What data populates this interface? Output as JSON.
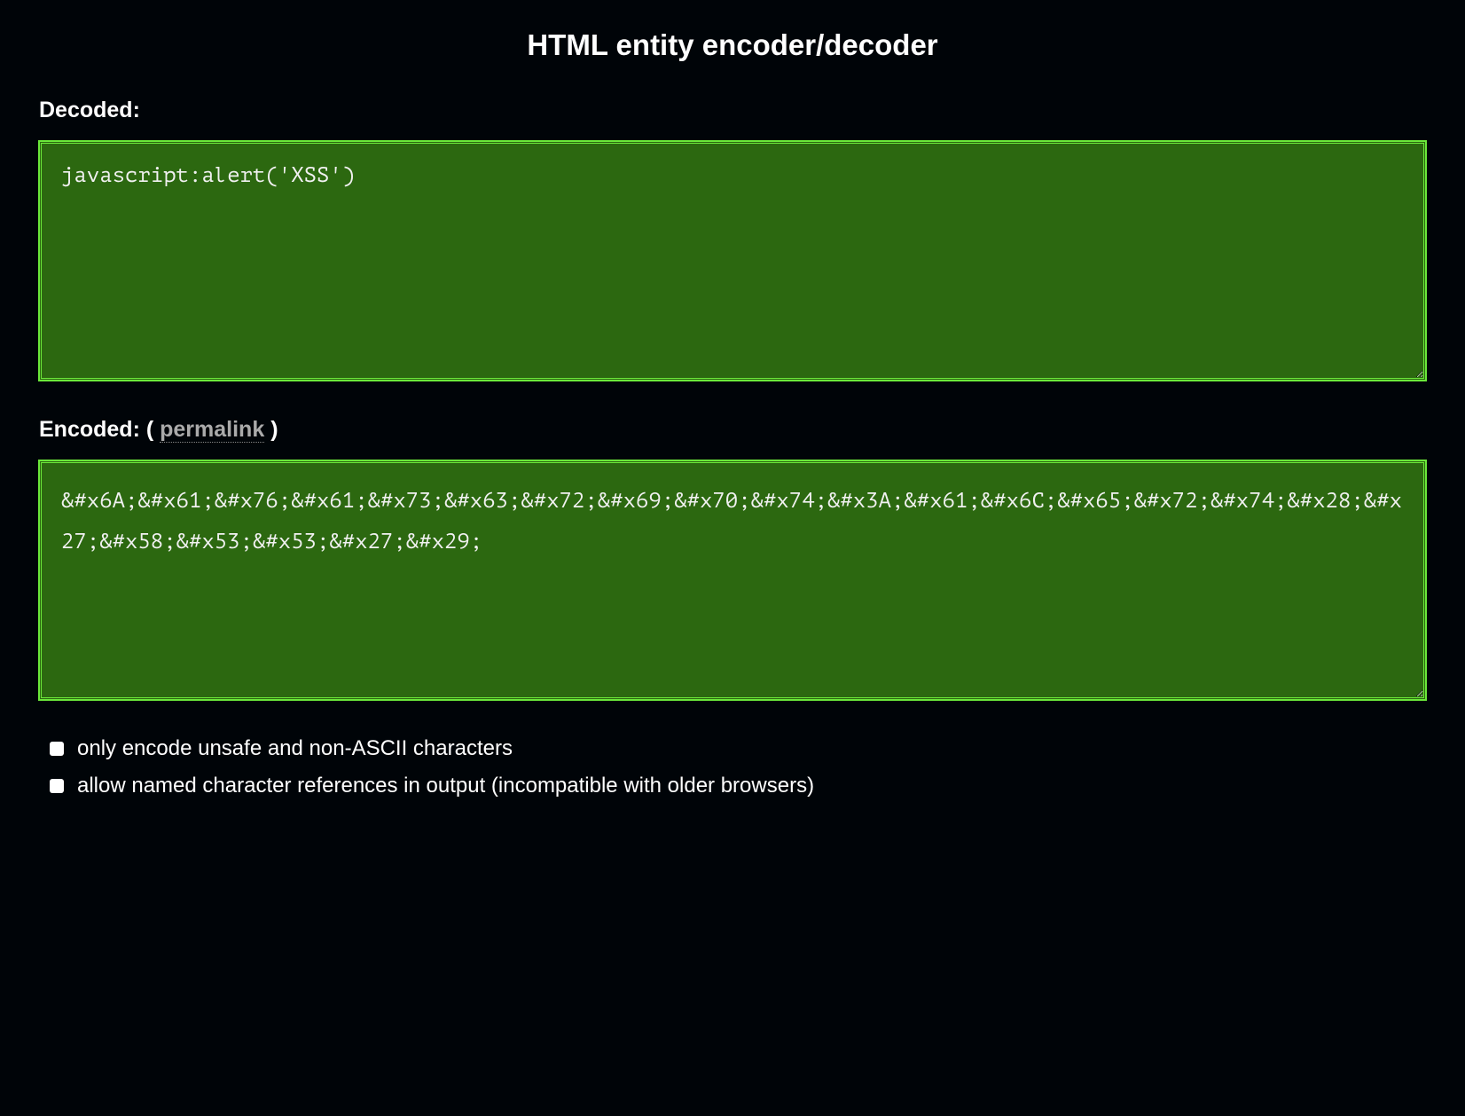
{
  "page_title": "HTML entity encoder/decoder",
  "decoded": {
    "label": "Decoded:",
    "value": "javascript:alert('XSS')"
  },
  "encoded": {
    "label_prefix": "Encoded: (",
    "permalink_text": "permalink",
    "label_suffix": ")",
    "value": "&#x6A;&#x61;&#x76;&#x61;&#x73;&#x63;&#x72;&#x69;&#x70;&#x74;&#x3A;&#x61;&#x6C;&#x65;&#x72;&#x74;&#x28;&#x27;&#x58;&#x53;&#x53;&#x27;&#x29;"
  },
  "options": [
    "only encode unsafe and non-ASCII characters",
    "allow named character references in output (incompatible with older browsers)"
  ]
}
